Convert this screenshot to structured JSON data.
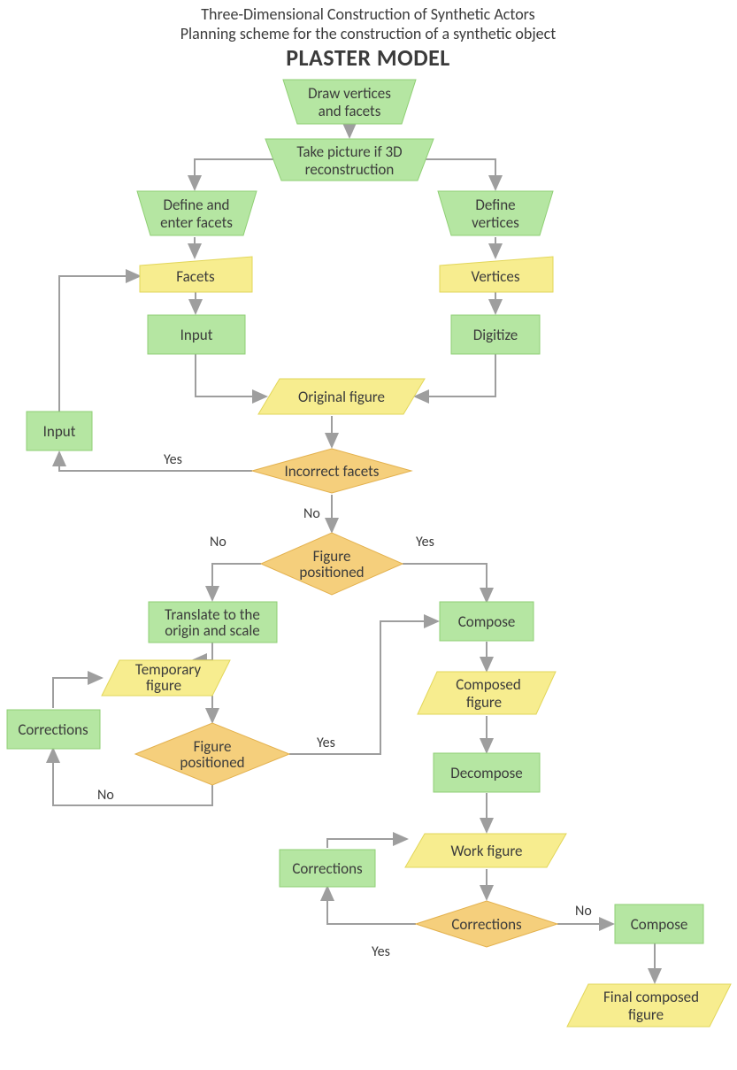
{
  "title_line1": "Three-Dimensional Construction of Synthetic Actors",
  "title_line2": "Planning scheme for the construction of a synthetic object",
  "title_line3": "PLASTER MODEL",
  "nodes": {
    "n1_l1": "Draw vertices",
    "n1_l2": "and facets",
    "n2_l1": "Take picture if 3D",
    "n2_l2": "reconstruction",
    "n3_l1": "Define and",
    "n3_l2": "enter facets",
    "n4_l1": "Define",
    "n4_l2": "vertices",
    "n5": "Facets",
    "n6": "Vertices",
    "n7": "Input",
    "n8": "Digitize",
    "n9": "Input",
    "n10": "Original figure",
    "n11": "Incorrect facets",
    "n12_l1": "Figure",
    "n12_l2": "positioned",
    "n13_l1": "Translate to the",
    "n13_l2": "origin and scale",
    "n14_l1": "Temporary",
    "n14_l2": "figure",
    "n15": "Corrections",
    "n16_l1": "Figure",
    "n16_l2": "positioned",
    "n17": "Compose",
    "n18_l1": "Composed",
    "n18_l2": "figure",
    "n19": "Decompose",
    "n20": "Work figure",
    "n21": "Corrections",
    "n22": "Corrections",
    "n23": "Compose",
    "n24_l1": "Final composed",
    "n24_l2": "figure"
  },
  "edge_labels": {
    "yes": "Yes",
    "no": "No"
  },
  "chart_data": {
    "type": "flowchart",
    "title": "Three-Dimensional Construction of Synthetic Actors — Planning scheme for the construction of a synthetic object — PLASTER MODEL",
    "nodes": [
      {
        "id": "n1",
        "shape": "manual-op",
        "label": "Draw vertices and facets"
      },
      {
        "id": "n2",
        "shape": "manual-op",
        "label": "Take picture if 3D reconstruction"
      },
      {
        "id": "n3",
        "shape": "manual-op",
        "label": "Define and enter facets"
      },
      {
        "id": "n4",
        "shape": "manual-op",
        "label": "Define vertices"
      },
      {
        "id": "n5",
        "shape": "manual-input",
        "label": "Facets"
      },
      {
        "id": "n6",
        "shape": "manual-input",
        "label": "Vertices"
      },
      {
        "id": "n7",
        "shape": "process",
        "label": "Input"
      },
      {
        "id": "n8",
        "shape": "process",
        "label": "Digitize"
      },
      {
        "id": "n9",
        "shape": "process",
        "label": "Input"
      },
      {
        "id": "n10",
        "shape": "data",
        "label": "Original figure"
      },
      {
        "id": "n11",
        "shape": "decision",
        "label": "Incorrect facets"
      },
      {
        "id": "n12",
        "shape": "decision",
        "label": "Figure positioned"
      },
      {
        "id": "n13",
        "shape": "process",
        "label": "Translate to the origin and scale"
      },
      {
        "id": "n14",
        "shape": "data",
        "label": "Temporary figure"
      },
      {
        "id": "n15",
        "shape": "process",
        "label": "Corrections"
      },
      {
        "id": "n16",
        "shape": "decision",
        "label": "Figure positioned"
      },
      {
        "id": "n17",
        "shape": "process",
        "label": "Compose"
      },
      {
        "id": "n18",
        "shape": "data",
        "label": "Composed figure"
      },
      {
        "id": "n19",
        "shape": "process",
        "label": "Decompose"
      },
      {
        "id": "n20",
        "shape": "data",
        "label": "Work figure"
      },
      {
        "id": "n21",
        "shape": "process",
        "label": "Corrections"
      },
      {
        "id": "n22",
        "shape": "decision",
        "label": "Corrections"
      },
      {
        "id": "n23",
        "shape": "process",
        "label": "Compose"
      },
      {
        "id": "n24",
        "shape": "data",
        "label": "Final composed figure"
      }
    ],
    "edges": [
      {
        "from": "n1",
        "to": "n2"
      },
      {
        "from": "n2",
        "to": "n3"
      },
      {
        "from": "n2",
        "to": "n4"
      },
      {
        "from": "n3",
        "to": "n5"
      },
      {
        "from": "n4",
        "to": "n6"
      },
      {
        "from": "n5",
        "to": "n7"
      },
      {
        "from": "n6",
        "to": "n8"
      },
      {
        "from": "n7",
        "to": "n10"
      },
      {
        "from": "n8",
        "to": "n10"
      },
      {
        "from": "n10",
        "to": "n11"
      },
      {
        "from": "n11",
        "to": "n9",
        "label": "Yes"
      },
      {
        "from": "n9",
        "to": "n5"
      },
      {
        "from": "n11",
        "to": "n12",
        "label": "No"
      },
      {
        "from": "n12",
        "to": "n13",
        "label": "No"
      },
      {
        "from": "n12",
        "to": "n17",
        "label": "Yes"
      },
      {
        "from": "n13",
        "to": "n14"
      },
      {
        "from": "n14",
        "to": "n16"
      },
      {
        "from": "n16",
        "to": "n15",
        "label": "No"
      },
      {
        "from": "n15",
        "to": "n14"
      },
      {
        "from": "n16",
        "to": "n17",
        "label": "Yes"
      },
      {
        "from": "n17",
        "to": "n18"
      },
      {
        "from": "n18",
        "to": "n19"
      },
      {
        "from": "n19",
        "to": "n20"
      },
      {
        "from": "n20",
        "to": "n22"
      },
      {
        "from": "n22",
        "to": "n21",
        "label": "Yes"
      },
      {
        "from": "n21",
        "to": "n20"
      },
      {
        "from": "n22",
        "to": "n23",
        "label": "No"
      },
      {
        "from": "n23",
        "to": "n24"
      }
    ]
  }
}
